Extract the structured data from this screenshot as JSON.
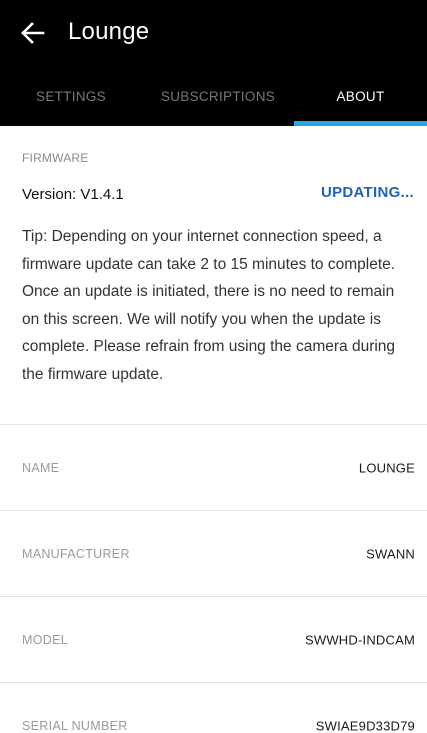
{
  "header": {
    "title": "Lounge",
    "back_icon": "arrow-left-icon"
  },
  "tabs": [
    {
      "label": "SETTINGS",
      "active": false
    },
    {
      "label": "SUBSCRIPTIONS",
      "active": false
    },
    {
      "label": "ABOUT",
      "active": true
    }
  ],
  "colors": {
    "header_bg": "#000000",
    "active_tab_indicator": "#27a6e0",
    "updating_link": "#1f63b8"
  },
  "firmware": {
    "section_label": "FIRMWARE",
    "version": "Version: V1.4.1",
    "status": "UPDATING...",
    "tip": "Tip: Depending on your internet connection speed, a firmware update can take 2 to 15 minutes to complete. Once an update is initiated, there is no need to remain on this screen. We will notify you when the update is complete. Please refrain from using the camera during the firmware update."
  },
  "info": {
    "name": {
      "label": "NAME",
      "value": "LOUNGE"
    },
    "manufacturer": {
      "label": "MANUFACTURER",
      "value": "SWANN"
    },
    "model": {
      "label": "MODEL",
      "value": "SWWHD-INDCAM"
    },
    "serial": {
      "label": "SERIAL NUMBER",
      "value": "SWIAE9D33D79"
    }
  }
}
